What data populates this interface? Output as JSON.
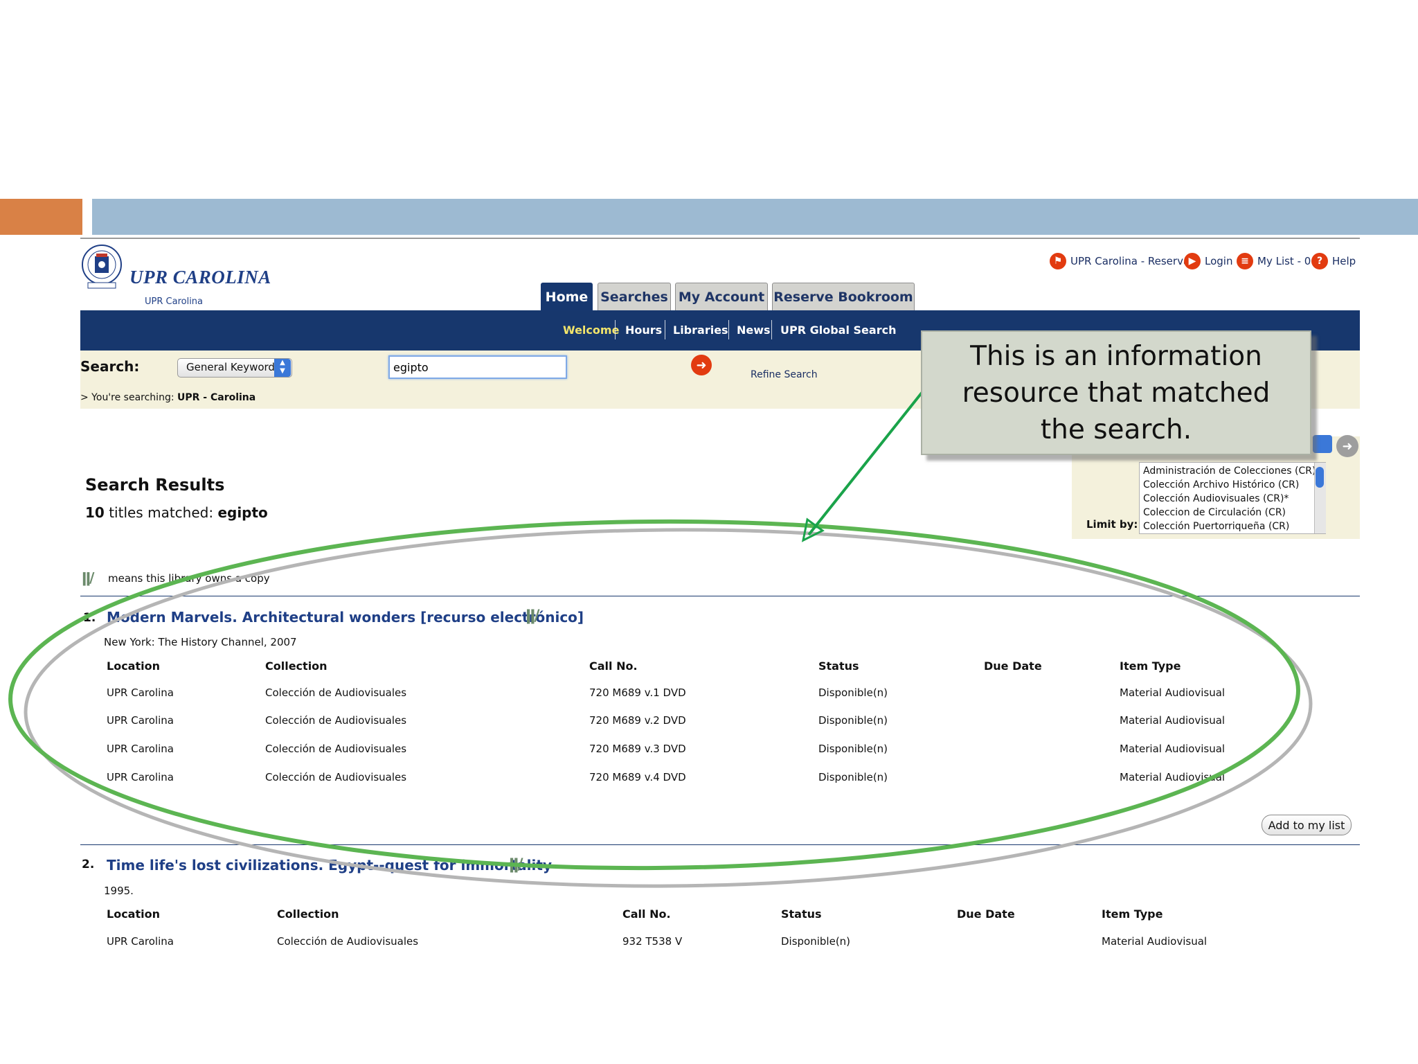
{
  "library": {
    "title": "UPR CAROLINA",
    "subtitle": "UPR Carolina"
  },
  "utility_links": [
    {
      "label": "UPR Carolina - Reserva",
      "icon": "flag-icon"
    },
    {
      "label": "Login",
      "icon": "arrow-right-icon"
    },
    {
      "label": "My List - 0",
      "icon": "list-icon"
    },
    {
      "label": "Help",
      "icon": "help-icon"
    }
  ],
  "tabs": [
    {
      "label": "Home",
      "active": true
    },
    {
      "label": "Searches",
      "active": false
    },
    {
      "label": "My Account",
      "active": false
    },
    {
      "label": "Reserve Bookroom",
      "active": false
    }
  ],
  "nav": {
    "welcome": "Welcome",
    "hours": "Hours",
    "libraries": "Libraries",
    "news": "News",
    "global": "UPR Global Search"
  },
  "search": {
    "label": "Search:",
    "type_selected": "General Keyword",
    "query": "egipto",
    "refine": "Refine Search",
    "searching_prefix": "> You're searching:",
    "searching_scope": "UPR - Carolina"
  },
  "limit": {
    "label": "Limit by:",
    "options": [
      "Administración de Colecciones (CR)",
      "Colección Archivo Histórico (CR)",
      "Colección Audiovisuales (CR)*",
      "Coleccion de Circulación (CR)",
      "Colección Puertorriqueña (CR)"
    ]
  },
  "results": {
    "title": "Search Results",
    "count": "10",
    "count_text": "titles matched:",
    "query": "egipto",
    "owns_legend": "means this library owns a copy",
    "owns_glyph": "ǁ/"
  },
  "columns": [
    "Location",
    "Collection",
    "Call No.",
    "Status",
    "Due Date",
    "Item Type"
  ],
  "items": [
    {
      "num": "1.",
      "title": "Modern Marvels. Architectural wonders [recurso electrónico]",
      "pub": "New York: The History Channel, 2007",
      "rows": [
        [
          "UPR Carolina",
          "Colección de Audiovisuales",
          "720 M689 v.1 DVD",
          "Disponible(n)",
          "",
          "Material Audiovisual"
        ],
        [
          "UPR Carolina",
          "Colección de Audiovisuales",
          "720 M689 v.2 DVD",
          "Disponible(n)",
          "",
          "Material Audiovisual"
        ],
        [
          "UPR Carolina",
          "Colección de Audiovisuales",
          "720 M689 v.3 DVD",
          "Disponible(n)",
          "",
          "Material Audiovisual"
        ],
        [
          "UPR Carolina",
          "Colección de Audiovisuales",
          "720 M689 v.4 DVD",
          "Disponible(n)",
          "",
          "Material Audiovisual"
        ]
      ],
      "add_label": "Add to my list"
    },
    {
      "num": "2.",
      "title": "Time life's lost civilizations. Egypt--quest for immortality",
      "pub": "1995.",
      "rows": [
        [
          "UPR Carolina",
          "Colección de Audiovisuales",
          "932 T538 V",
          "Disponible(n)",
          "",
          "Material Audiovisual"
        ]
      ]
    }
  ],
  "callout": {
    "text": "This is an information resource that matched the search."
  },
  "colors": {
    "accent_orange": "#d98146",
    "header_blue": "#9dbad2",
    "nav_navy": "#17376d",
    "highlight_green": "#4caf50",
    "arrow_green": "#1aa34a"
  }
}
